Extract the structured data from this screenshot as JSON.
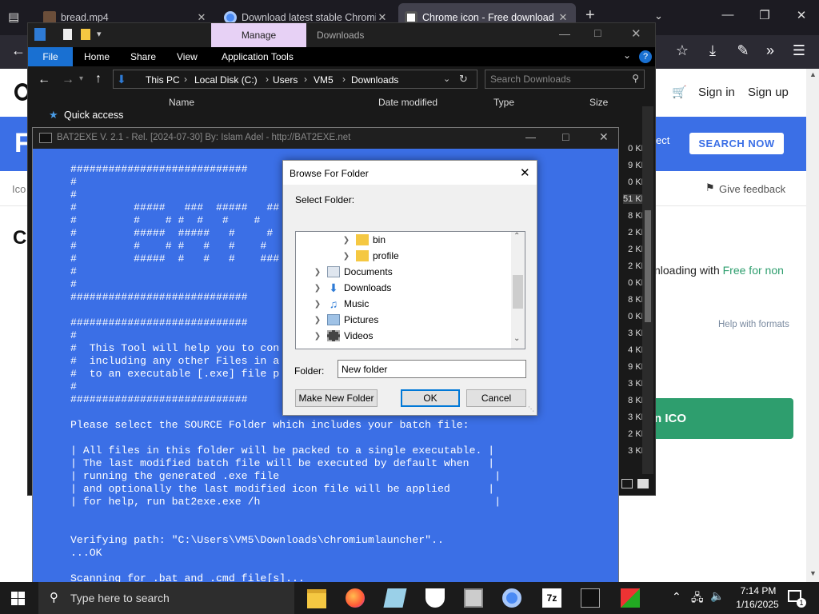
{
  "browser": {
    "tabs": [
      {
        "label": "bread.mp4"
      },
      {
        "label": "Download latest stable Chromi"
      },
      {
        "label": "Chrome icon - Free download &"
      }
    ],
    "new_tab": "+"
  },
  "website": {
    "nav_links": [
      "Sign in",
      "Sign up"
    ],
    "search_button": "SEARCH NOW",
    "banner_partial": "ect",
    "breadcrumb_partial": "Ico",
    "feedback": "Give feedback",
    "heading_partial": "C",
    "download_text": "nloading with",
    "download_link": "Free for non",
    "help_link": "Help with formats",
    "download_button_partial": "n ICO"
  },
  "explorer": {
    "manage_tab": "Manage",
    "title": "Downloads",
    "ribbon_tabs": [
      "File",
      "Home",
      "Share",
      "View",
      "Application Tools"
    ],
    "breadcrumb": [
      "This PC",
      "Local Disk (C:)",
      "Users",
      "VM5",
      "Downloads"
    ],
    "search_placeholder": "Search Downloads",
    "quick_access": "Quick access",
    "columns": [
      "Name",
      "Date modified",
      "Type",
      "Size"
    ],
    "sizes": [
      "0 KB",
      "9 KB",
      "0 KB",
      "51 KB",
      "8 KB",
      "2 KB",
      "2 KB",
      "2 KB",
      "0 KB",
      "8 KB",
      "0 KB",
      "3 KB",
      "4 KB",
      "9 KB",
      "3 KB",
      "8 KB",
      "3 KB",
      "2 KB",
      "3 KB"
    ]
  },
  "console": {
    "title": "BAT2EXE V. 2.1 - Rel. [2024-07-30] By: Islam Adel - http://BAT2EXE.net",
    "lines": [
      "############################",
      "#",
      "#",
      "#         #####   ###  #####   ##",
      "#         #    # #  #   #    #",
      "#         #####  #####   #     #",
      "#         #    # #   #   #    #",
      "#         #####  #   #   #    ###",
      "#",
      "#",
      "############################",
      "",
      "############################",
      "#",
      "#  This Tool will help you to con",
      "#  including any other Files in a",
      "#  to an executable [.exe] file p",
      "#",
      "############################",
      "",
      "Please select the SOURCE Folder which includes your batch file:",
      "",
      "| All files in this folder will be packed to a single executable. |",
      "| The last modified batch file will be executed by default when   |",
      "| running the generated .exe file                                  |",
      "| and optionally the last modified icon file will be applied      |",
      "| for help, run bat2exe.exe /h                                     |",
      "",
      "",
      "Verifying path: \"C:\\Users\\VM5\\Downloads\\chromiumlauncher\"..",
      "...OK",
      "",
      "Scanning for .bat and .cmd file[s]..."
    ]
  },
  "dialog": {
    "title": "Browse For Folder",
    "prompt": "Select Folder:",
    "tree": [
      {
        "label": "bin",
        "indent": 2,
        "icon": "folder-icon"
      },
      {
        "label": "profile",
        "indent": 2,
        "icon": "folder-icon"
      },
      {
        "label": "Documents",
        "indent": 1,
        "icon": "documents-icon"
      },
      {
        "label": "Downloads",
        "indent": 1,
        "icon": "download-icon"
      },
      {
        "label": "Music",
        "indent": 1,
        "icon": "music-icon"
      },
      {
        "label": "Pictures",
        "indent": 1,
        "icon": "pictures-icon"
      },
      {
        "label": "Videos",
        "indent": 1,
        "icon": "videos-icon"
      }
    ],
    "folder_label": "Folder:",
    "folder_value": "New folder",
    "buttons": {
      "new_folder": "Make New Folder",
      "ok": "OK",
      "cancel": "Cancel"
    }
  },
  "taskbar": {
    "search_placeholder": "Type here to search",
    "time": "7:14 PM",
    "date": "1/16/2025",
    "notification_count": "1"
  },
  "colors": {
    "console_blue": "#3b6fe6",
    "explorer_manage": "#e7d1f5",
    "ribbon_file": "#1970d2",
    "download_button": "#2e9e6e",
    "link_green": "#2e9e6e"
  }
}
